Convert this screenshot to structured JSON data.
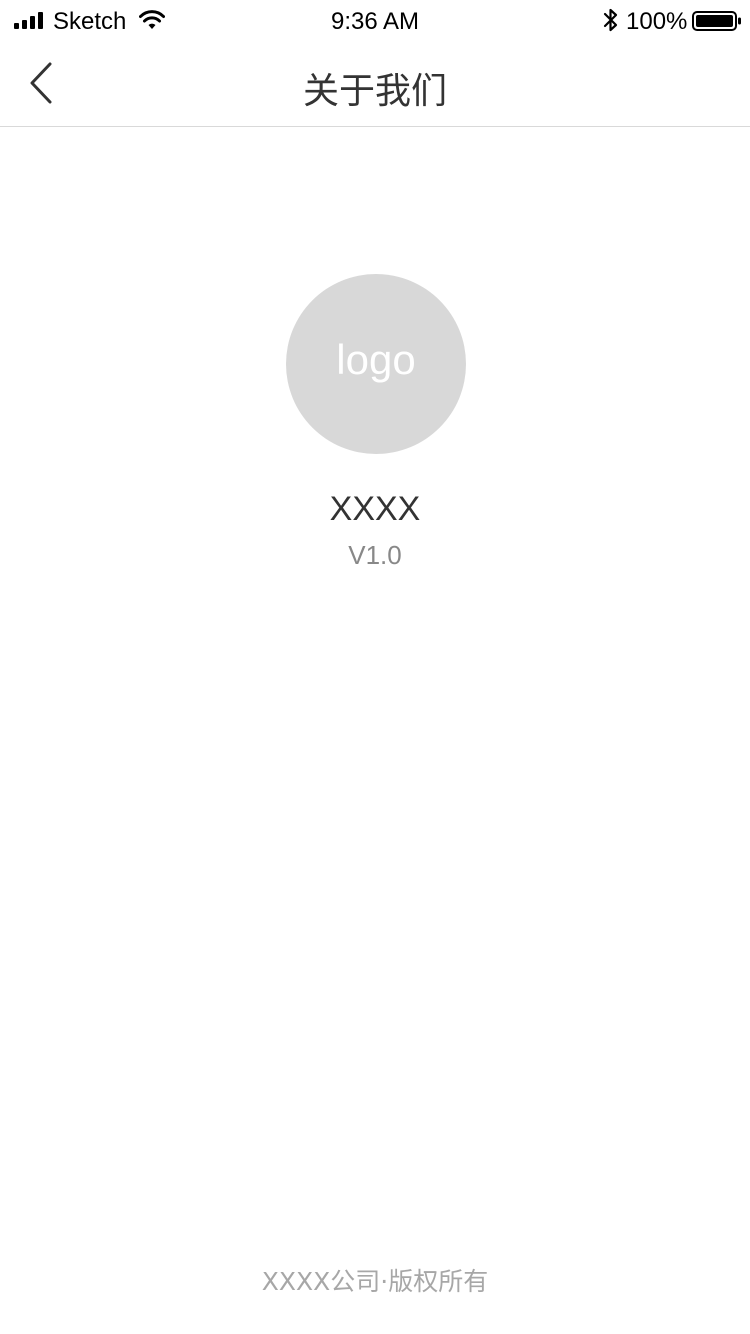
{
  "status_bar": {
    "carrier": "Sketch",
    "time": "9:36 AM",
    "battery_percent": "100%",
    "icons": [
      "signal-icon",
      "wifi-icon",
      "bluetooth-icon",
      "battery-icon"
    ]
  },
  "nav": {
    "title": "关于我们",
    "back_icon": "chevron-left-icon"
  },
  "logo": {
    "text": "logo",
    "background": "#d8d8d8"
  },
  "app": {
    "name": "XXXX",
    "version": "V1.0"
  },
  "footer": {
    "copyright": "XXXX公司·版权所有"
  }
}
